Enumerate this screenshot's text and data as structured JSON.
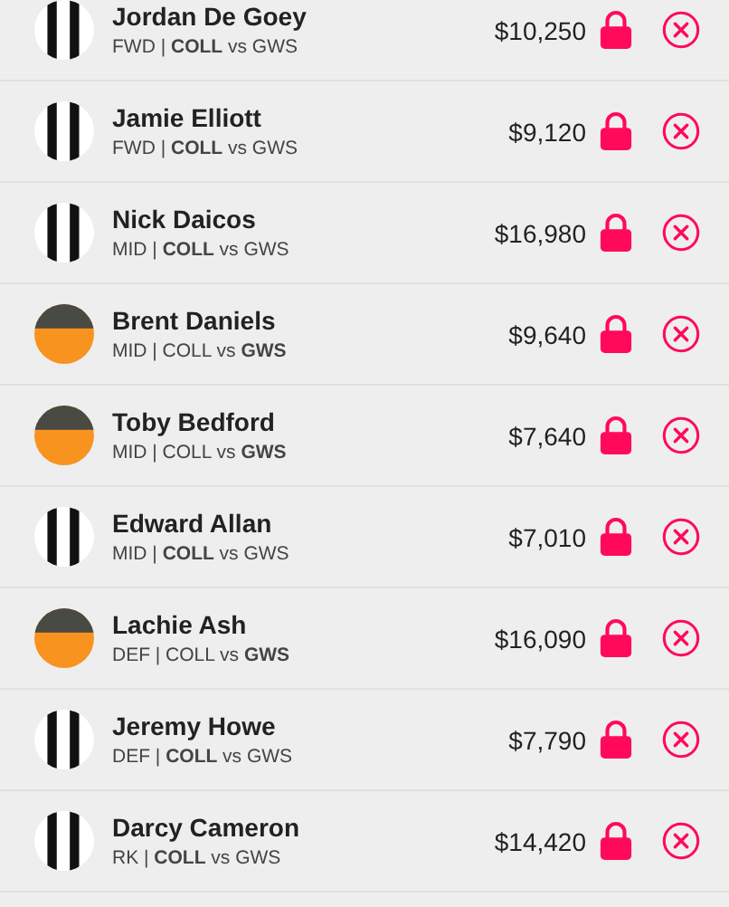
{
  "players": [
    {
      "name": "Jordan De Goey",
      "info": "FWD | **COLL** vs GWS",
      "price": "$10,250",
      "kind": "stripes",
      "locked": true
    },
    {
      "name": "Jamie Elliott",
      "info": "FWD | **COLL** vs GWS",
      "price": "$9,120",
      "kind": "stripes",
      "locked": true
    },
    {
      "name": "Nick Daicos",
      "info": "MID | **COLL** vs GWS",
      "price": "$16,980",
      "kind": "stripes",
      "locked": true
    },
    {
      "name": "Brent Daniels",
      "info": "MID | COLL vs **GWS**",
      "price": "$9,640",
      "kind": "halves",
      "locked": true
    },
    {
      "name": "Toby Bedford",
      "info": "MID | COLL vs **GWS**",
      "price": "$7,640",
      "kind": "halves",
      "locked": true
    },
    {
      "name": "Edward Allan",
      "info": "MID | **COLL** vs GWS",
      "price": "$7,010",
      "kind": "stripes",
      "locked": true
    },
    {
      "name": "Lachie Ash",
      "info": "DEF | COLL vs **GWS**",
      "price": "$16,090",
      "kind": "halves",
      "locked": true
    },
    {
      "name": "Jeremy Howe",
      "info": "DEF | **COLL** vs GWS",
      "price": "$7,790",
      "kind": "stripes",
      "locked": true
    },
    {
      "name": "Darcy Cameron",
      "info": "RK | **COLL** vs GWS",
      "price": "$14,420",
      "kind": "stripes",
      "locked": true
    }
  ]
}
